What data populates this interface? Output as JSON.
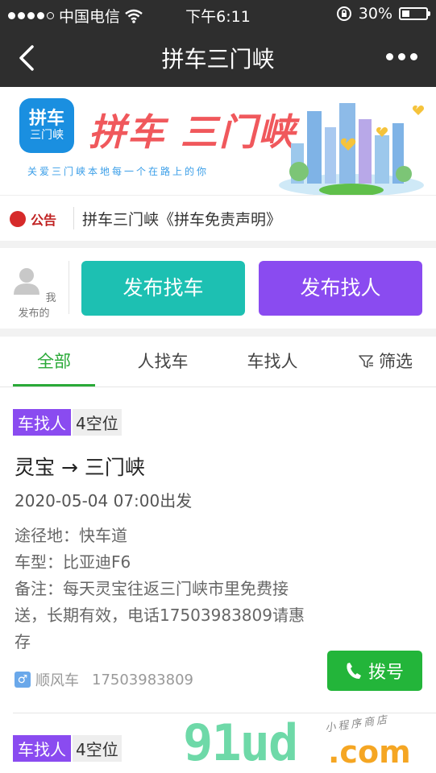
{
  "status_bar": {
    "carrier": "中国电信",
    "time": "下午6:11",
    "battery": "30%"
  },
  "nav": {
    "title": "拼车三门峡"
  },
  "banner": {
    "logo_line1": "拼车",
    "logo_line2": "三门峡",
    "title": "拼车 三门峡",
    "slogan": "关爱三门峡本地每一个在路上的你"
  },
  "notice": {
    "badge": "公告",
    "text": "拼车三门峡《拼车免责声明》"
  },
  "post": {
    "my_posts": "我发布的",
    "find_car": "发布找车",
    "find_person": "发布找人"
  },
  "tabs": [
    {
      "label": "全部"
    },
    {
      "label": "人找车"
    },
    {
      "label": "车找人"
    },
    {
      "label": "筛选"
    }
  ],
  "listings": [
    {
      "type": "车找人",
      "seats": "4空位",
      "route_from": "灵宝",
      "route_arrow": "→",
      "route_to": "三门峡",
      "depart": "2020-05-04 07:00出发",
      "via": "途径地：快车道",
      "car": "车型：比亚迪F6",
      "note": "备注：每天灵宝往返三门峡市里免费接送，长期有效，电话17503983809请惠存",
      "category": "顺风车",
      "phone": "17503983809",
      "dial": "拨号"
    },
    {
      "type": "车找人",
      "seats": "4空位"
    }
  ],
  "watermark": {
    "brand": "91ud",
    "suffix": ".com",
    "tagline": "小程序商店"
  },
  "colors": {
    "nav_bg": "#2e2e2e",
    "teal": "#1dc0b2",
    "purple": "#8a4bf0",
    "green": "#29a937",
    "dial": "#23b53a"
  }
}
